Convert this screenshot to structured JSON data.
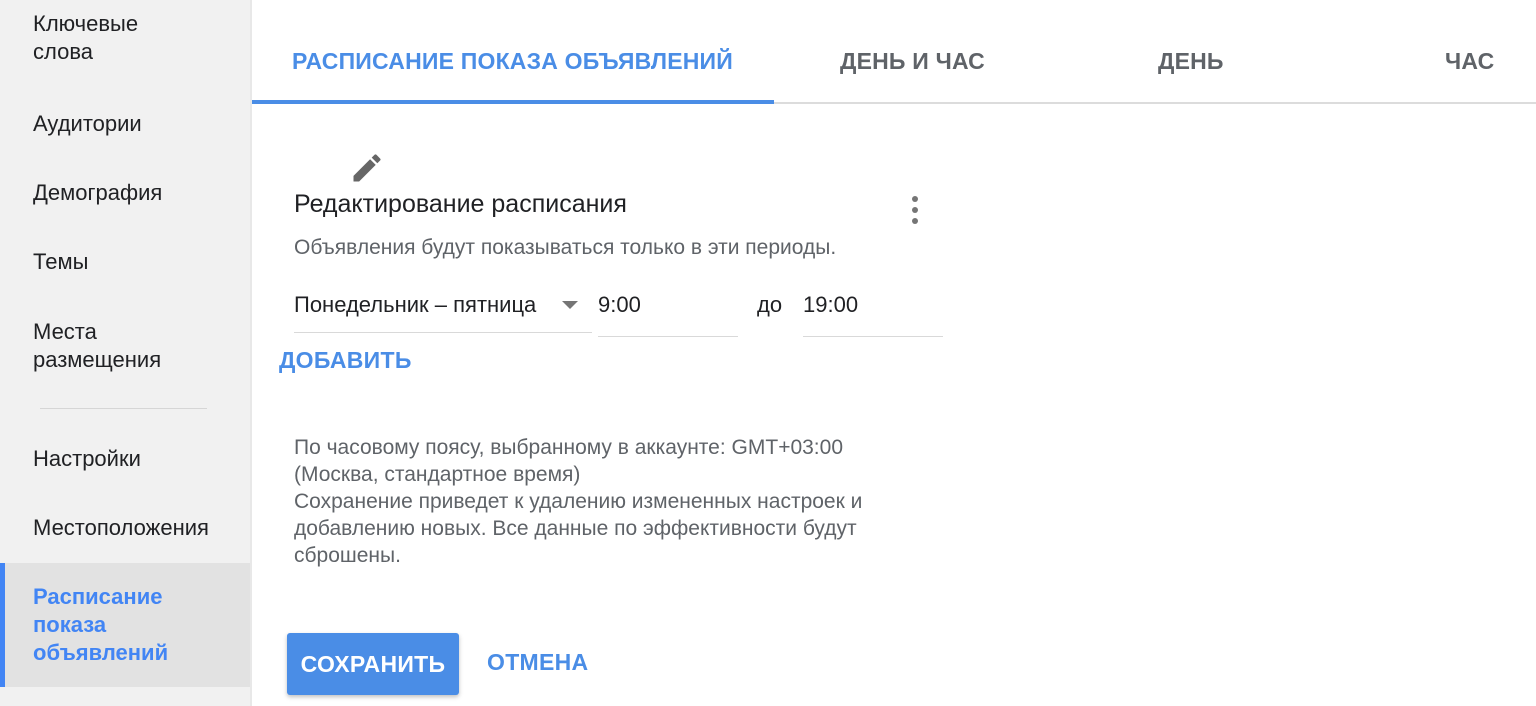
{
  "sidebar": {
    "items": [
      {
        "label": "Ключевые слова",
        "selected": false
      },
      {
        "label": "Аудитории",
        "selected": false
      },
      {
        "label": "Демография",
        "selected": false
      },
      {
        "label": "Темы",
        "selected": false
      },
      {
        "label": "Места размещения",
        "selected": false
      },
      {
        "label": "Настройки",
        "selected": false
      },
      {
        "label": "Местоположения",
        "selected": false
      },
      {
        "label": "Расписание показа объявлений",
        "selected": true
      }
    ]
  },
  "tabs": [
    {
      "label": "РАСПИСАНИЕ ПОКАЗА ОБЪЯВЛЕНИЙ",
      "active": true
    },
    {
      "label": "ДЕНЬ И ЧАС",
      "active": false
    },
    {
      "label": "ДЕНЬ",
      "active": false
    },
    {
      "label": "ЧАС",
      "active": false
    }
  ],
  "editor": {
    "edit_icon": "pencil-icon",
    "more_icon": "more-vert-icon",
    "title": "Редактирование расписания",
    "description": "Объявления будут показываться только в эти периоды.",
    "schedule_row": {
      "days": "Понедельник – пятница",
      "start_time": "9:00",
      "to_label": "до",
      "end_time": "19:00"
    },
    "add_label": "ДОБАВИТЬ",
    "timezone_line1": "По часовому поясу, выбранному в аккаунте: GMT+03:00",
    "timezone_line2": "(Москва, стандартное время)",
    "warning_line1": "Сохранение приведет к удалению измененных настроек и",
    "warning_line2": "добавлению новых. Все данные по эффективности будут",
    "warning_line3": "сброшены.",
    "save_label": "СОХРАНИТЬ",
    "cancel_label": "ОТМЕНА"
  },
  "colors": {
    "accent": "#4a8de6",
    "sidebar_bg": "#f1f1f1",
    "sidebar_selected_bg": "#e2e2e2",
    "text_primary": "#202124",
    "text_secondary": "#5f6368"
  }
}
